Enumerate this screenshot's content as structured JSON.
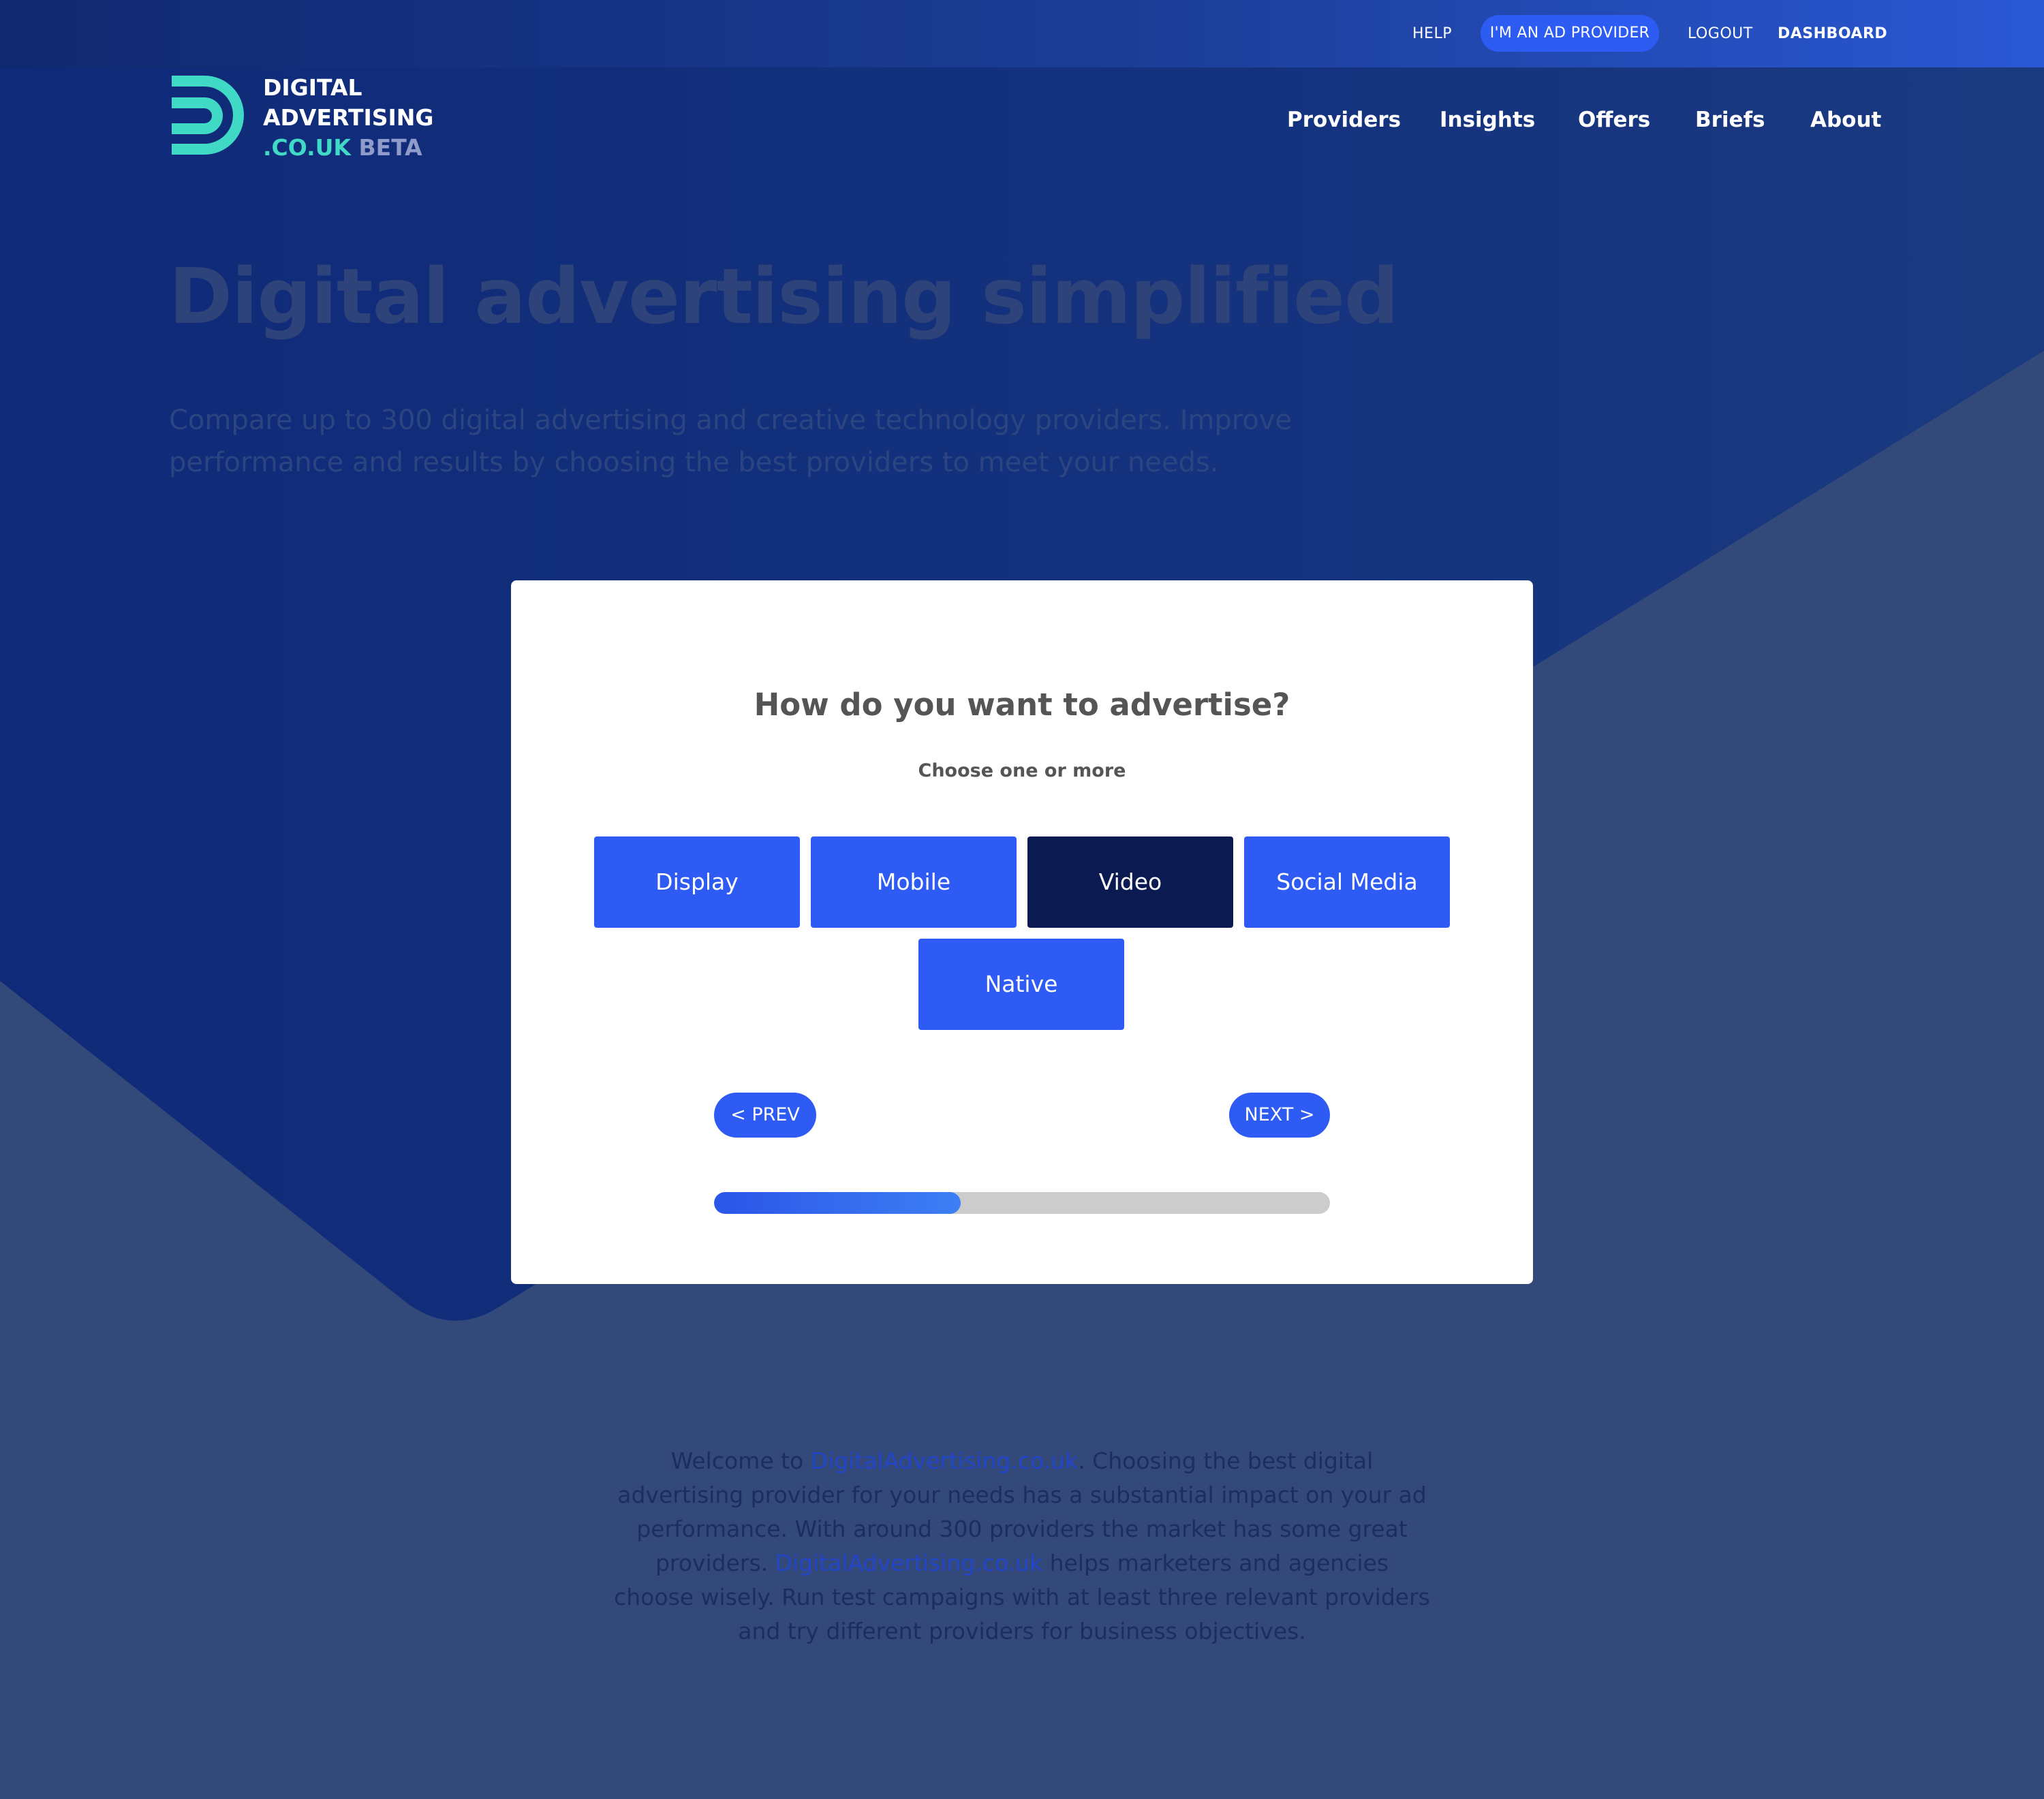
{
  "topbar": {
    "help": "HELP",
    "provider_button": "I'M AN AD PROVIDER",
    "logout": "LOGOUT",
    "dashboard": "DASHBOARD"
  },
  "logo": {
    "line1": "DIGITAL",
    "line2": "ADVERTISING",
    "tld": ".CO.UK",
    "beta": "BETA",
    "colors": {
      "mark": "#3fd9c5",
      "beta": "#8f9bc8"
    }
  },
  "nav": {
    "items": [
      "Providers",
      "Insights",
      "Offers",
      "Briefs",
      "About"
    ]
  },
  "hero": {
    "title": "Digital advertising simplified",
    "subtitle": "Compare up to 300 digital advertising and creative technology providers. Improve performance and results by choosing the best providers to meet your needs."
  },
  "wizard": {
    "question": "How do you want to advertise?",
    "hint": "Choose one or more",
    "options": [
      {
        "label": "Display",
        "selected": false
      },
      {
        "label": "Mobile",
        "selected": false
      },
      {
        "label": "Video",
        "selected": true
      },
      {
        "label": "Social Media",
        "selected": false
      },
      {
        "label": "Native",
        "selected": false
      }
    ],
    "prev_label": "< PREV",
    "next_label": "NEXT >",
    "progress_fraction": 0.4,
    "colors": {
      "button": "#2d5bf4",
      "selected": "#0c1a52",
      "track": "#cccccc"
    }
  },
  "intro": {
    "part1": "Welcome to ",
    "link1": "DigitalAdvertising.co.uk",
    "part2": ". Choosing the best digital advertising provider for your needs has a substantial impact on your ad performance. With around 300 providers the market has some great providers. ",
    "link2": "DigitalAdvertising.co.uk",
    "part3": " helps marketers and agencies choose wisely. Run test campaigns with at least three relevant providers and try different providers for business objectives."
  }
}
